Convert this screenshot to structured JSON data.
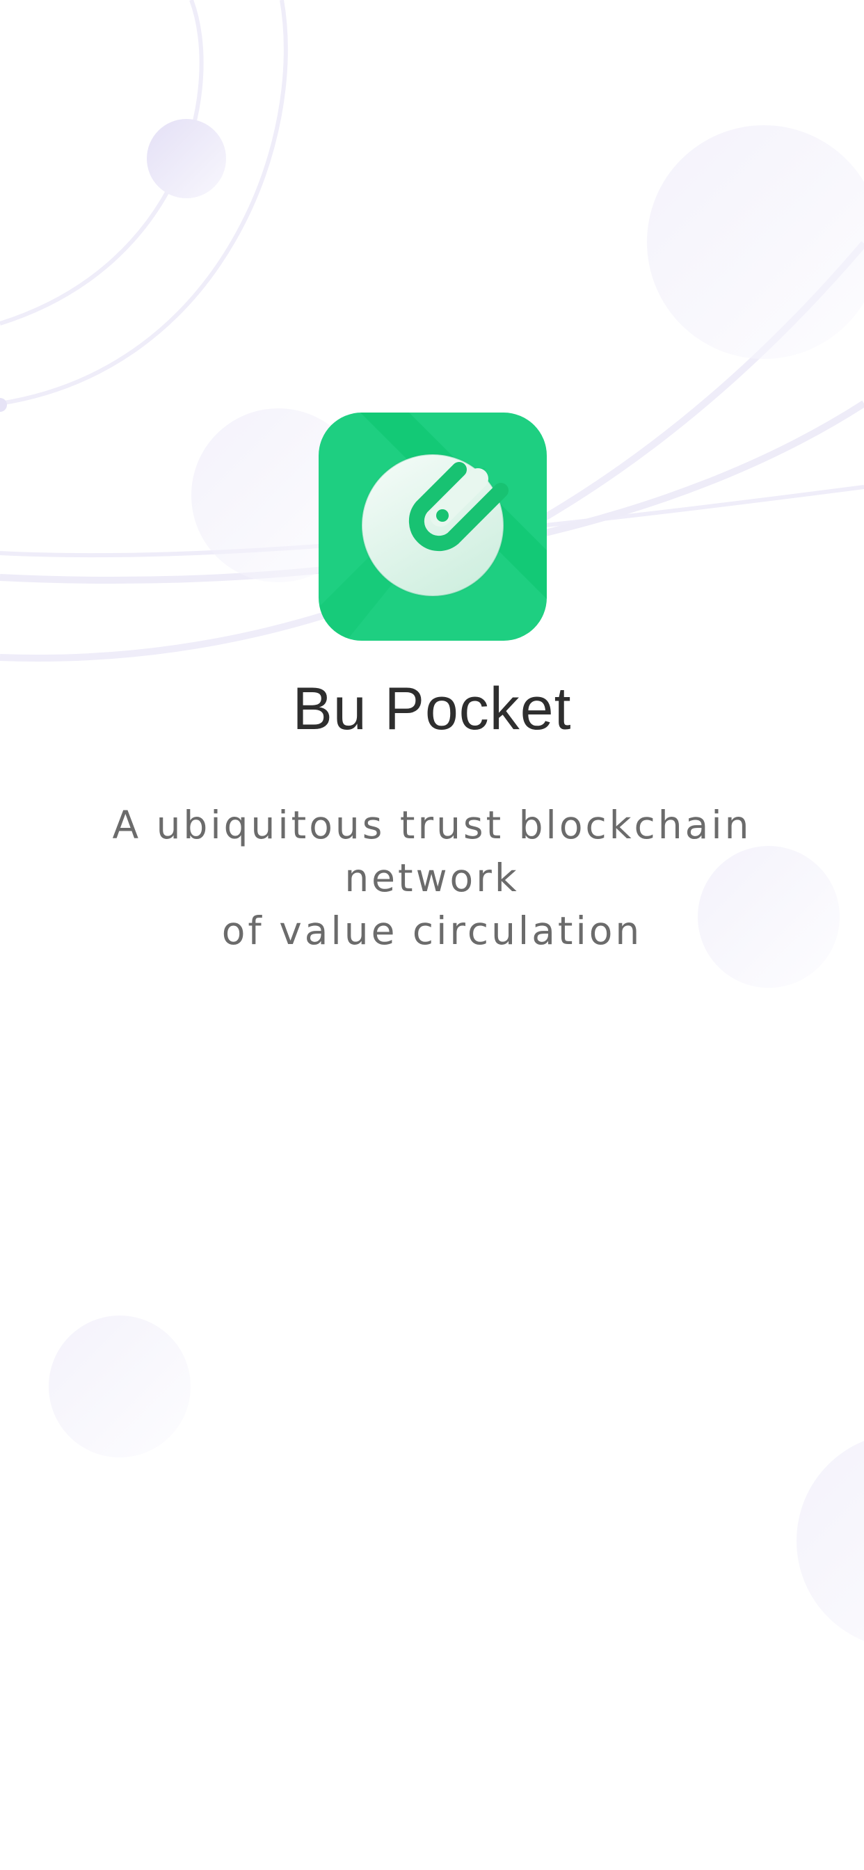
{
  "splash": {
    "app_name": "Bu Pocket",
    "tagline_line1": "A ubiquitous trust blockchain network",
    "tagline_line2": "of value circulation",
    "logo_icon": "bu-pocket-logo-icon"
  },
  "colors": {
    "brand_green": "#1ecf81",
    "brand_green_dark": "#0bc46d",
    "decor_lilac": "#ece9f7",
    "title_text": "#2e2e2e",
    "tagline_text": "#6b6b6b"
  }
}
